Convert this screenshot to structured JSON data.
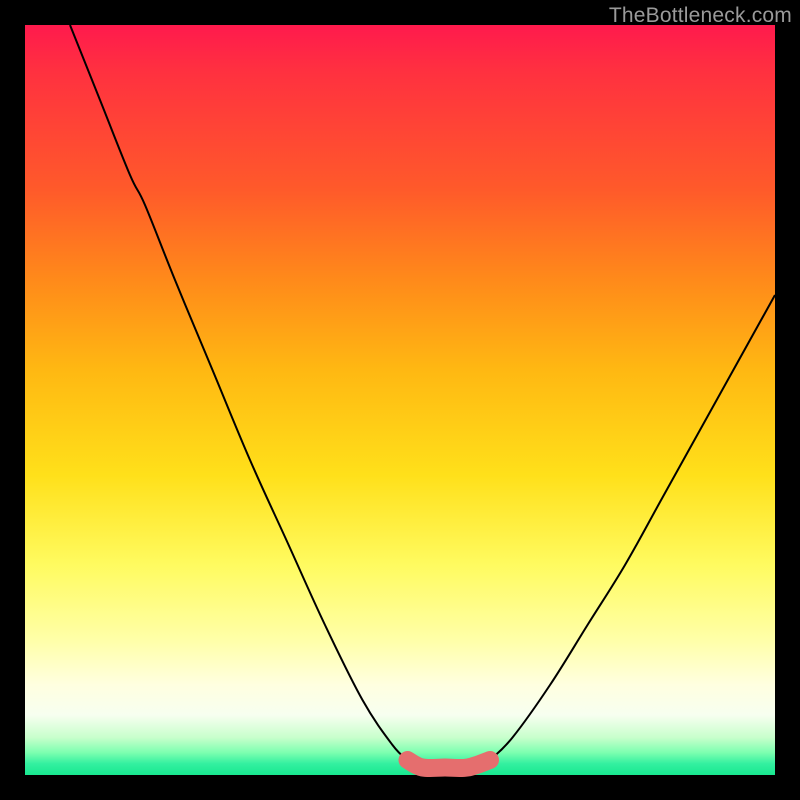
{
  "watermark": "TheBottleneck.com",
  "chart_data": {
    "type": "line",
    "title": "",
    "xlabel": "",
    "ylabel": "",
    "xlim": [
      0,
      100
    ],
    "ylim": [
      0,
      100
    ],
    "grid": false,
    "background_gradient_axis": "y",
    "background_gradient_stops": [
      {
        "pos": 0,
        "color": "#18e890"
      },
      {
        "pos": 2,
        "color": "#33f0a0"
      },
      {
        "pos": 5,
        "color": "#c8ffcc"
      },
      {
        "pos": 10,
        "color": "#ffffe0"
      },
      {
        "pos": 18,
        "color": "#ffffa8"
      },
      {
        "pos": 28,
        "color": "#fffb60"
      },
      {
        "pos": 40,
        "color": "#ffe01a"
      },
      {
        "pos": 54,
        "color": "#ffb812"
      },
      {
        "pos": 66,
        "color": "#ff8a1a"
      },
      {
        "pos": 78,
        "color": "#ff5a2a"
      },
      {
        "pos": 94,
        "color": "#ff3040"
      },
      {
        "pos": 100,
        "color": "#ff1a4d"
      }
    ],
    "series": [
      {
        "name": "left-curve",
        "stroke": "#000000",
        "x": [
          6,
          10,
          14,
          16,
          20,
          25,
          30,
          35,
          40,
          45,
          49,
          51
        ],
        "y": [
          100,
          90,
          80,
          76,
          66,
          54,
          42,
          31,
          20,
          10,
          4,
          2
        ]
      },
      {
        "name": "right-curve",
        "stroke": "#000000",
        "x": [
          62,
          65,
          70,
          75,
          80,
          85,
          90,
          95,
          100
        ],
        "y": [
          2,
          5,
          12,
          20,
          28,
          37,
          46,
          55,
          64
        ]
      },
      {
        "name": "flat-bottom",
        "stroke": "#e56e6e",
        "x": [
          51,
          53,
          56,
          59,
          62
        ],
        "y": [
          2,
          1,
          1,
          1,
          2
        ]
      }
    ],
    "optimum_range_x": [
      51,
      62
    ]
  }
}
